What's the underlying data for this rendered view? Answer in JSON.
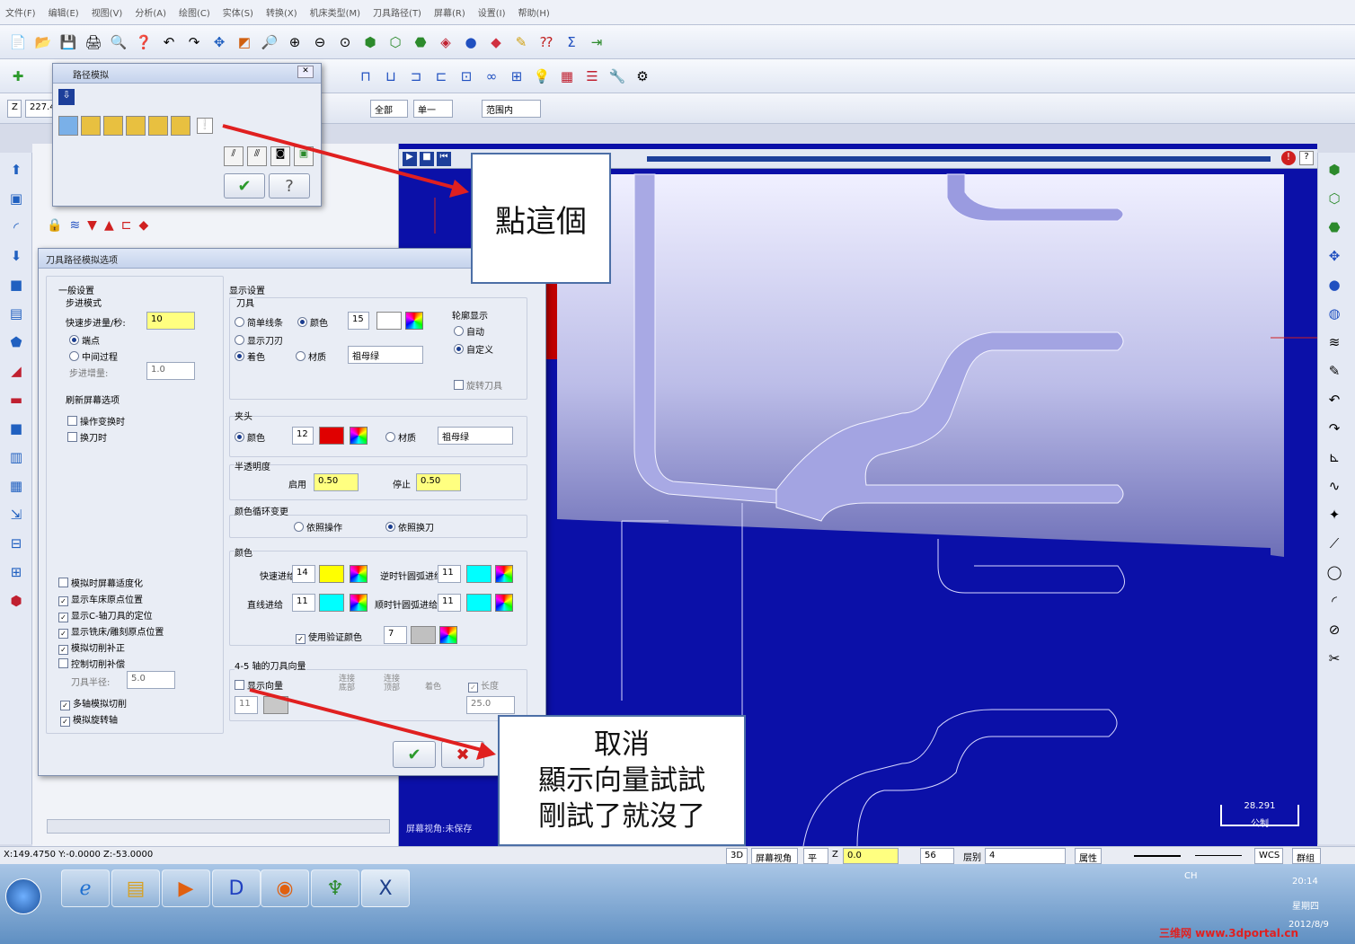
{
  "menu": [
    "文件(F)",
    "编辑(E)",
    "视图(V)",
    "分析(A)",
    "绘图(C)",
    "实体(S)",
    "转换(X)",
    "机床类型(M)",
    "刀具路径(T)",
    "屏幕(R)",
    "设置(I)",
    "帮助(H)"
  ],
  "toolbar": {
    "coord_value": "227.4",
    "level_field": "全部",
    "single_field": "单一",
    "range_field": "范围内"
  },
  "path_sim_dialog": {
    "title": "路径模拟"
  },
  "options_dialog": {
    "title": "刀具路径模拟选项",
    "general": {
      "heading": "一般设置",
      "step_mode": "步进模式",
      "fast_step_label": "快速步进量/秒:",
      "fast_step_value": "10",
      "endpoint": "端点",
      "intermediate": "中间过程",
      "step_increment_label": "步进增量:",
      "step_increment_value": "1.0",
      "refresh_heading": "刷新屏幕选项",
      "on_op_change": "操作变换时",
      "on_tool_change": "换刀时",
      "options": [
        {
          "label": "模拟时屏幕适度化",
          "checked": false
        },
        {
          "label": "显示车床原点位置",
          "checked": true
        },
        {
          "label": "显示C-轴刀具的定位",
          "checked": true
        },
        {
          "label": "显示铣床/雕刻原点位置",
          "checked": true
        },
        {
          "label": "模拟切削补正",
          "checked": true
        },
        {
          "label": "控制切削补偿",
          "checked": false
        }
      ],
      "tool_radius_label": "刀具半径:",
      "tool_radius_value": "5.0",
      "multi_axis": "多轴模拟切削",
      "rotary_axis": "模拟旋转轴"
    },
    "display": {
      "heading": "显示设置",
      "tool": "刀具",
      "simple_lines": "简单线条",
      "color": "颜色",
      "show_blade": "显示刀刃",
      "material": "材质",
      "shaded": "着色",
      "tool_color_num": "15",
      "material_value": "祖母绿",
      "contour_heading": "轮廓显示",
      "auto": "自动",
      "custom": "自定义",
      "rotate_tool": "旋转刀具",
      "holder": "夹头",
      "holder_color_num": "12",
      "holder_material": "祖母绿",
      "transparency": "半透明度",
      "enable": "启用",
      "enable_value": "0.50",
      "stop": "停止",
      "stop_value": "0.50",
      "color_cycle": "颜色循环变更",
      "by_operation": "依照操作",
      "by_tool_change": "依照换刀",
      "colors": "颜色",
      "rapid": "快速进给",
      "rapid_num": "14",
      "ccw_arc": "逆时针圆弧进给",
      "ccw_num": "11",
      "linear": "直线进给",
      "linear_num": "11",
      "cw_arc": "顺时针圆弧进给",
      "cw_num": "11",
      "verify_color": "使用验证颜色",
      "verify_num": "7",
      "vector_heading": "4-5 轴的刀具向量",
      "show_vector": "显示向量",
      "connect_1": "连接\n底部",
      "connect_2": "连接\n顶部",
      "shaded2": "着色",
      "length": "长度",
      "vector_num": "11",
      "length_value": "25.0"
    }
  },
  "callouts": {
    "click_this": "點這個",
    "cancel_line1": "取消",
    "cancel_line2": "顯示向量試試",
    "cancel_line3": "剛試了就沒了"
  },
  "viewport": {
    "scale_value": "28.291",
    "scale_unit": "公制",
    "hint": "屏幕视角:未保存"
  },
  "status": {
    "coords": "X:149.4750   Y:-0.0000   Z:-53.0000",
    "mode_3d": "3D",
    "screen_view": "屏幕视角",
    "plane": "平面",
    "z_label": "Z",
    "z_value": "0.0",
    "level": "56",
    "layer_label": "层别",
    "layer_value": "4",
    "attributes": "属性",
    "wcs": "WCS",
    "group": "群组"
  },
  "taskbar": {
    "ime": "CH",
    "time": "20:14",
    "weekday": "星期四",
    "date": "2012/8/9",
    "watermark": "三维网 www.3dportal.cn"
  },
  "colors": {
    "viewport": "#0b10a8",
    "arrow": "#e02020",
    "yellow": "#ffff00",
    "cyan": "#00ffff",
    "holder": "#e00000"
  }
}
